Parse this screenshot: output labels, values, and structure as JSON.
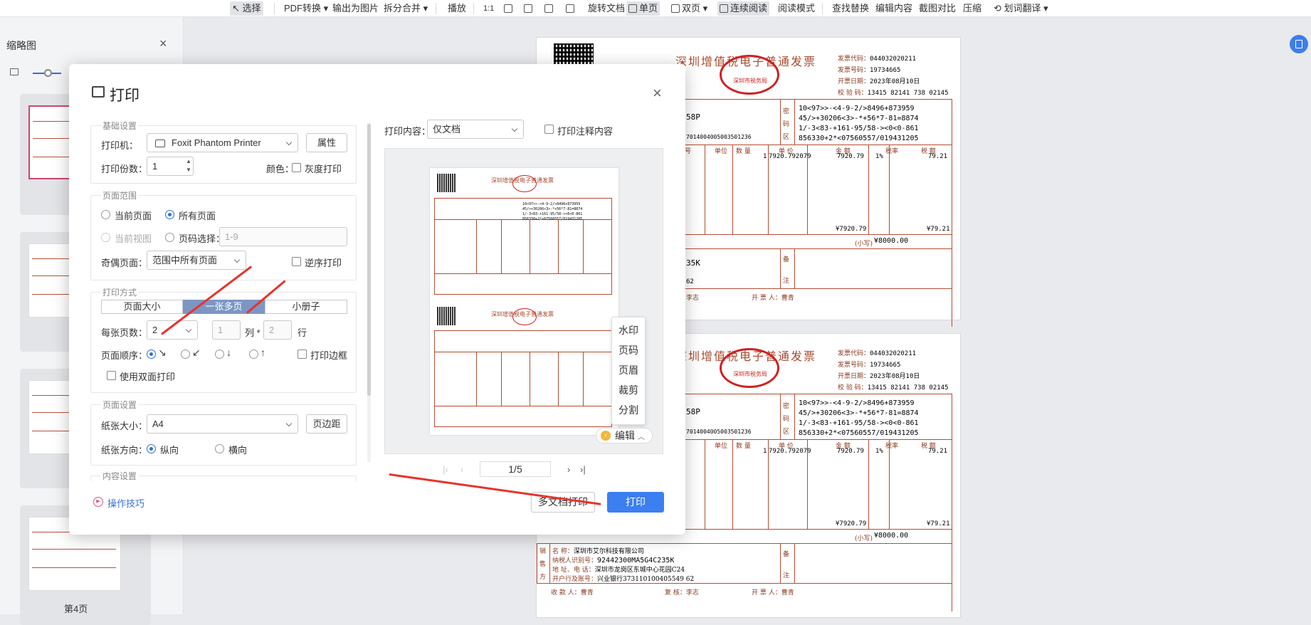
{
  "toolbar": {
    "items": [
      "选择",
      "PDF转换",
      "输出为图片",
      "拆分合并",
      "播放",
      "旋转文档",
      "单页",
      "双页",
      "连续阅读",
      "阅读模式",
      "查找替换",
      "编辑内容",
      "截图对比",
      "压缩",
      "划词翻译"
    ]
  },
  "sidebar": {
    "title": "缩略图",
    "last_label": "第4页"
  },
  "dialog": {
    "title": "打印",
    "basic": {
      "label": "基础设置",
      "printer_label": "打印机：",
      "printer_value": "Foxit Phantom Printer",
      "properties_btn": "属性",
      "copies_label": "打印份数：",
      "copies_value": "1",
      "color_label": "颜色：",
      "grayscale_label": "灰度打印"
    },
    "range": {
      "label": "页面范围",
      "current_page": "当前页面",
      "all_pages": "所有页面",
      "current_view": "当前视图",
      "page_select": "页码选择：",
      "page_select_placeholder": "1-9",
      "odd_even_label": "奇偶页面：",
      "odd_even_value": "范围中所有页面",
      "reverse_label": "逆序打印"
    },
    "mode": {
      "label": "打印方式",
      "tabs": [
        "页面大小",
        "一张多页",
        "小册子"
      ],
      "per_sheet_label": "每张页数：",
      "per_sheet_value": "2",
      "cols_placeholder": "1",
      "cols_label": "列 *",
      "rows_placeholder": "2",
      "rows_label": "行",
      "order_label": "页面顺序：",
      "border_label": "打印边框",
      "duplex_label": "使用双面打印"
    },
    "page_setup": {
      "label": "页面设置",
      "paper_label": "纸张大小：",
      "paper_value": "A4",
      "margin_btn": "页边距",
      "orientation_label": "纸张方向：",
      "portrait": "纵向",
      "landscape": "横向"
    },
    "content_label": "内容设置",
    "tips": "操作技巧",
    "print_content_label": "打印内容：",
    "print_content_value": "仅文档",
    "print_annotations": "打印注释内容",
    "context_menu": [
      "水印",
      "页码",
      "页眉",
      "裁剪",
      "分割"
    ],
    "edit_btn": "编辑",
    "page_indicator": "1/5",
    "multi_print_btn": "多文档打印",
    "print_btn": "打印"
  },
  "invoice": {
    "title": "深圳增值税电子普通发票",
    "seal": "深圳市税务局",
    "code_label": "发票代码：",
    "code": "044032020211",
    "number_label": "发票号码：",
    "number": "19734665",
    "date_label": "开票日期：",
    "date": "2023年08月10日",
    "check_label": "校 验 码：",
    "check": "13415 82141 738 02145",
    "cipher": [
      "10<97>>-<4-9-2/>8496+873959",
      "45/>+30206<3>-*+56*7-81=8874",
      "1/-3<83-+161-95/58-><0<0-861",
      "856330+2*<07560557/019431205"
    ],
    "cipher_side": [
      "密",
      "码",
      "区"
    ],
    "buyer_tail_a": "58P",
    "buyer_tail_b": "7014004005003501236",
    "col_unit": "单位",
    "col_qty": "数 量",
    "col_price": "单 价",
    "col_amount": "金 额",
    "col_rate": "税率",
    "col_tax": "税 额",
    "qty": "1",
    "price": "7920.792079",
    "amount": "7920.79",
    "rate": "1%",
    "tax": "79.21",
    "amount_total": "¥7920.79",
    "tax_total": "¥79.21",
    "small_label": "(小写)",
    "total": "¥8000.00",
    "seller_tail": "35K",
    "seller_tail2": "62",
    "remark": "备注",
    "reviewer": "李志",
    "issuer_label": "开 票 人：",
    "issuer": "曹青",
    "seller_name_label": "名 称：",
    "seller_name": "深圳市艾尔科技有限公司",
    "seller_tax_label": "纳税人识别号：",
    "seller_tax": "92442300MA5G4C235K",
    "seller_addr_label": "地 址、电 话：",
    "seller_addr": "深圳市龙岗区东城中心花园C24",
    "seller_bank_label": "开户行及账号：",
    "seller_bank": "兴业银行373110100405549 62",
    "payee_label": "收 款 人：",
    "reviewer_label": "复 核：",
    "seller_side": [
      "销",
      "售",
      "方"
    ]
  }
}
